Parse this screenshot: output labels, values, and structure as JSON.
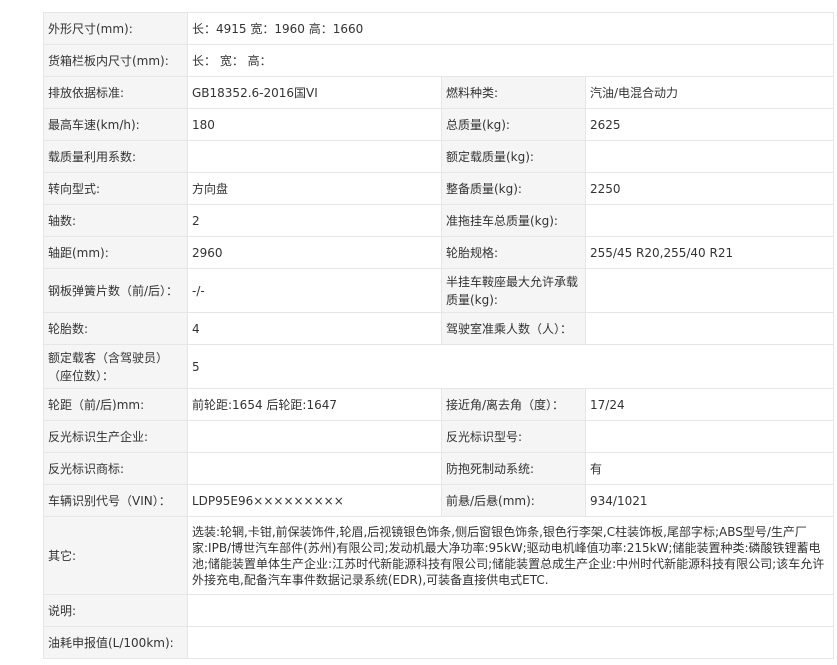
{
  "rows": [
    {
      "type": "wide",
      "label": "外形尺寸(mm):",
      "value": "长：4915 宽：1960 高：1660"
    },
    {
      "type": "wide",
      "label": "货箱栏板内尺寸(mm):",
      "value": "长： 宽： 高："
    },
    {
      "type": "pair",
      "label1": "排放依据标准:",
      "value1": "GB18352.6-2016国VI",
      "label2": "燃料种类:",
      "value2": "汽油/电混合动力"
    },
    {
      "type": "pair",
      "label1": "最高车速(km/h):",
      "value1": "180",
      "label2": "总质量(kg):",
      "value2": "2625"
    },
    {
      "type": "pair",
      "label1": "载质量利用系数:",
      "value1": "",
      "label2": "额定载质量(kg):",
      "value2": ""
    },
    {
      "type": "pair",
      "label1": "转向型式:",
      "value1": "方向盘",
      "label2": "整备质量(kg):",
      "value2": "2250"
    },
    {
      "type": "pair",
      "label1": "轴数:",
      "value1": "2",
      "label2": "准拖挂车总质量(kg):",
      "value2": ""
    },
    {
      "type": "pair",
      "label1": "轴距(mm):",
      "value1": "2960",
      "label2": "轮胎规格:",
      "value2": "255/45 R20,255/40 R21"
    },
    {
      "type": "pair",
      "label1": "钢板弹簧片数（前/后）：",
      "value1": "-/-",
      "label2": "半挂车鞍座最大允许承载质量(kg):",
      "value2": ""
    },
    {
      "type": "pair",
      "label1": "轮胎数:",
      "value1": "4",
      "label2": "驾驶室准乘人数（人）：",
      "value2": ""
    },
    {
      "type": "wide",
      "label": "额定载客（含驾驶员）（座位数）：",
      "value": "5"
    },
    {
      "type": "pair",
      "label1": "轮距（前/后)mm:",
      "value1": "前轮距:1654 后轮距:1647",
      "label2": "接近角/离去角（度）：",
      "value2": "17/24"
    },
    {
      "type": "pair",
      "label1": "反光标识生产企业:",
      "value1": "",
      "label2": "反光标识型号:",
      "value2": ""
    },
    {
      "type": "pair",
      "label1": "反光标识商标:",
      "value1": "",
      "label2": "防抱死制动系统:",
      "value2": "有"
    },
    {
      "type": "pair",
      "label1": "车辆识别代号（VIN）：",
      "value1": "LDP95E96×××××××××",
      "label2": "前悬/后悬(mm):",
      "value2": "934/1021"
    },
    {
      "type": "wide",
      "label": "其它:",
      "value": "选装:轮辋,卡钳,前保装饰件,轮眉,后视镜银色饰条,侧后窗银色饰条,银色行李架,C柱装饰板,尾部字标;ABS型号/生产厂家:IPB/博世汽车部件(苏州)有限公司;发动机最大净功率:95kW;驱动电机峰值功率:215kW;储能装置种类:磷酸铁锂蓄电池;储能装置单体生产企业:江苏时代新能源科技有限公司;储能装置总成生产企业:中州时代新能源科技有限公司;该车允许外接充电,配备汽车事件数据记录系统(EDR),可装备直接供电式ETC."
    },
    {
      "type": "wide",
      "label": "说明:",
      "value": ""
    },
    {
      "type": "wide",
      "label": "油耗申报值(L/100km):",
      "value": ""
    }
  ]
}
